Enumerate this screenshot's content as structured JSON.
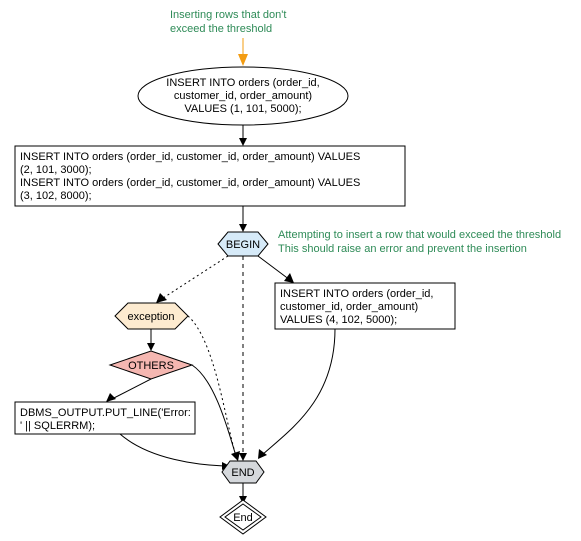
{
  "comments": {
    "top1": "Inserting rows that don't",
    "top2": "exceed the threshold",
    "mid1": "Attempting to insert a row that would exceed the threshold",
    "mid2": "This should raise an error and prevent the insertion"
  },
  "nodes": {
    "ellipse_l1": "INSERT INTO orders (order_id,",
    "ellipse_l2": "customer_id, order_amount)",
    "ellipse_l3": "VALUES (1, 101, 5000);",
    "rect1_l1": "INSERT INTO orders (order_id, customer_id, order_amount) VALUES",
    "rect1_l2": "(2, 101, 3000);",
    "rect1_l3": "INSERT INTO orders (order_id, customer_id, order_amount) VALUES",
    "rect1_l4": "(3, 102, 8000);",
    "begin": "BEGIN",
    "rect2_l1": "INSERT INTO orders (order_id,",
    "rect2_l2": "customer_id, order_amount)",
    "rect2_l3": "VALUES (4, 102, 5000);",
    "exception": "exception",
    "others": "OTHERS",
    "putline_l1": "DBMS_OUTPUT.PUT_LINE('Error:",
    "putline_l2": "' || SQLERRM);",
    "endhex": "END",
    "enddiamond": "End"
  }
}
